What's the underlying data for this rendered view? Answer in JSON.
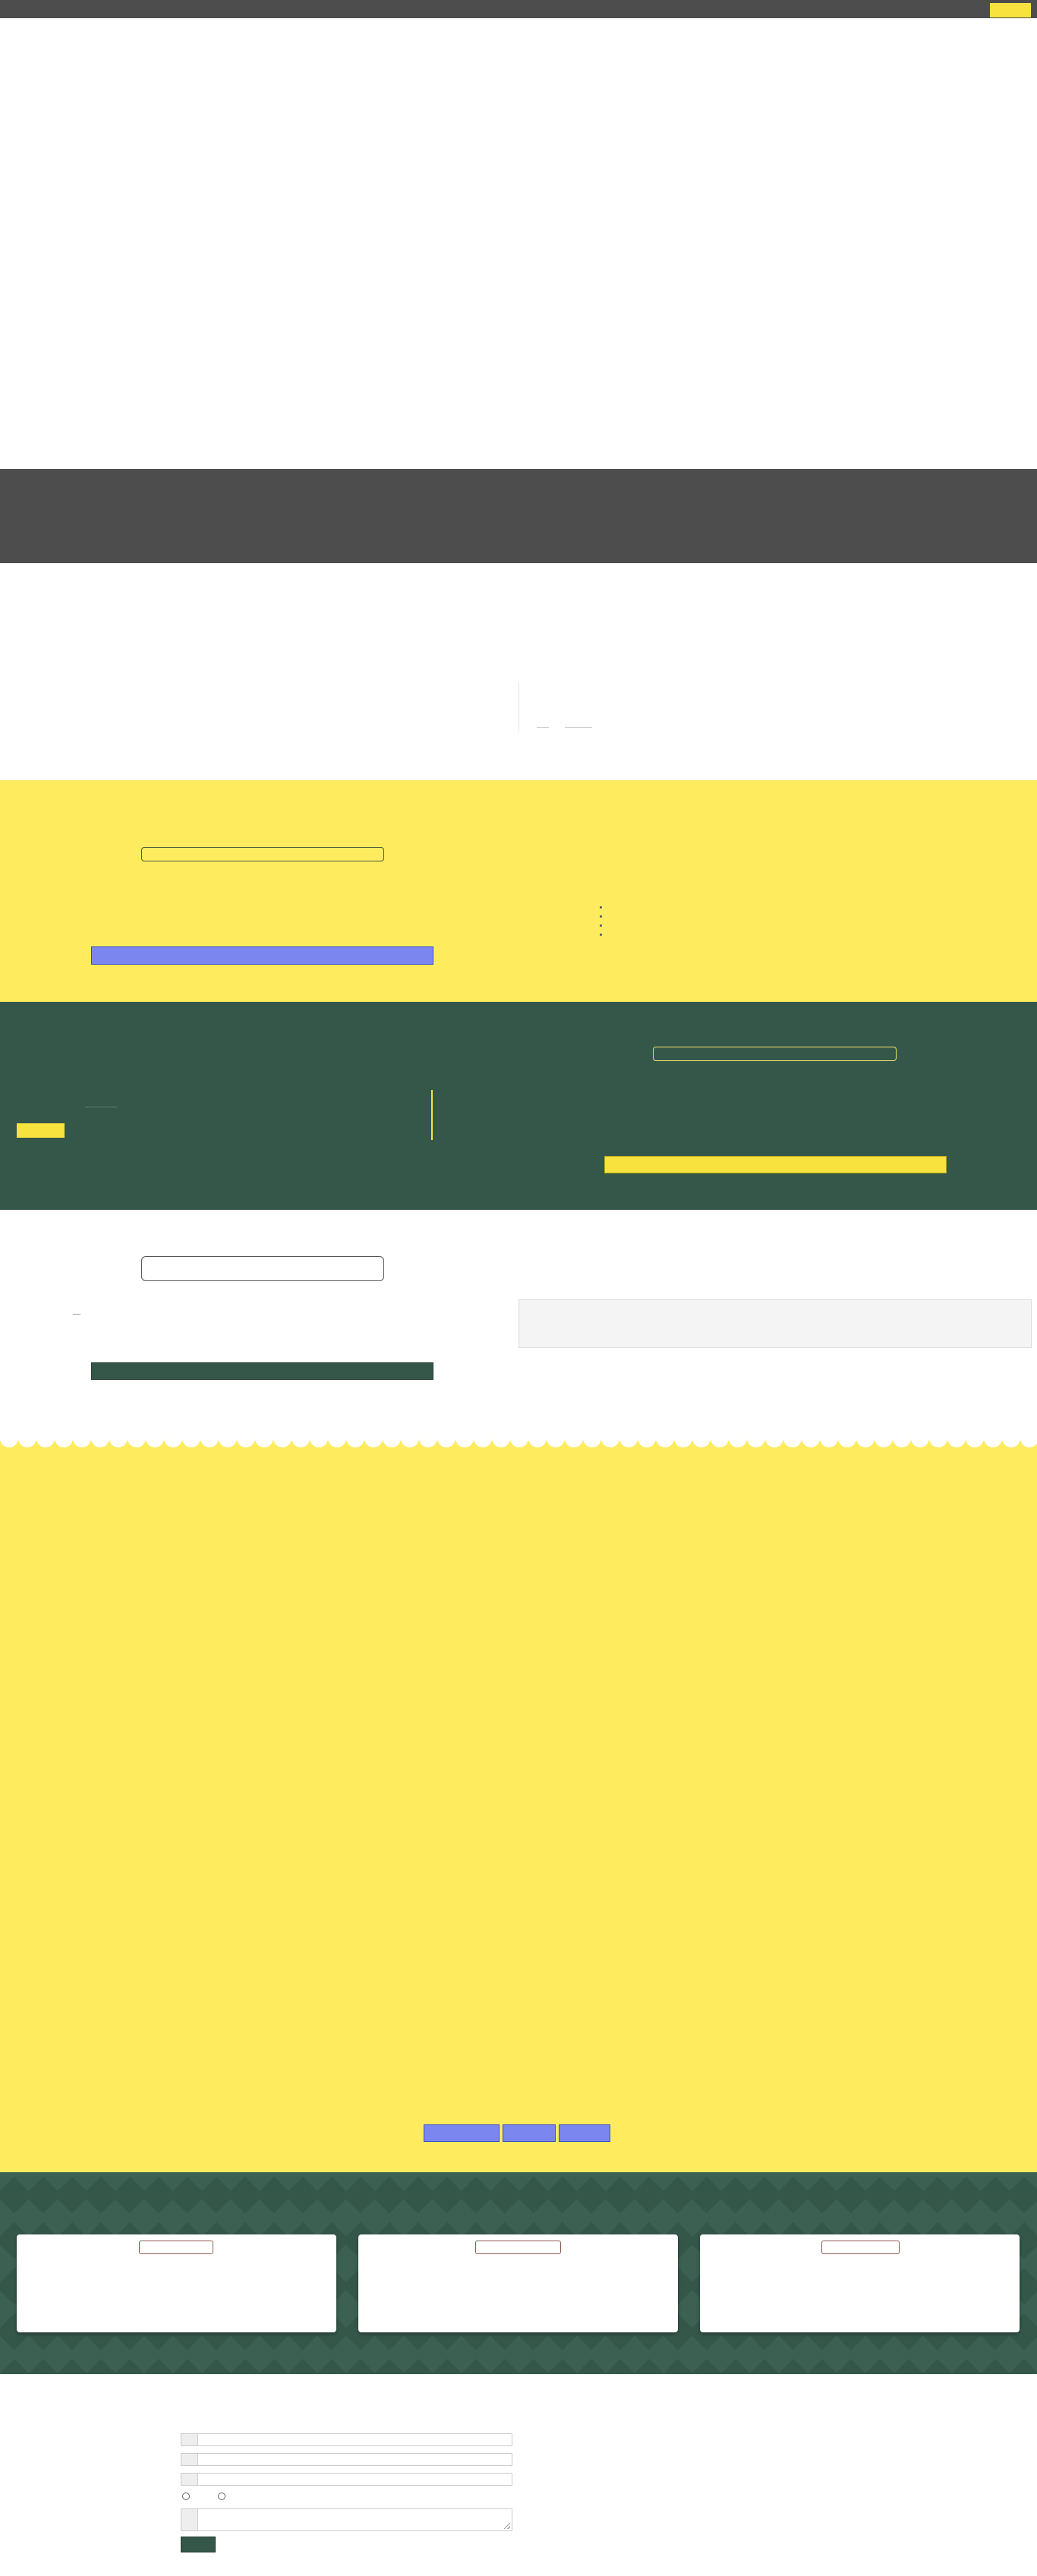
{
  "colors": {
    "nav_dark": "#4d4d4d",
    "accent_yellow": "#f7e23e",
    "section_yellow": "#feeb5e",
    "section_green": "#35574a",
    "button_blue": "#7b86ee"
  },
  "nav": {
    "cta_label": ""
  },
  "yellow_section": {
    "input_value": "",
    "button_label": ""
  },
  "green_section": {
    "input_value": "",
    "tag_label": "",
    "button_label": ""
  },
  "white_section": {
    "input_value": "",
    "button_label": ""
  },
  "pagination": {
    "buttons": [
      "",
      "",
      ""
    ]
  },
  "cards": [
    {
      "tag": ""
    },
    {
      "tag": ""
    },
    {
      "tag": ""
    }
  ],
  "contact_form": {
    "field_1": "",
    "field_2": "",
    "field_3": "",
    "radio_1": "",
    "radio_2": "",
    "message": "",
    "submit_label": ""
  }
}
